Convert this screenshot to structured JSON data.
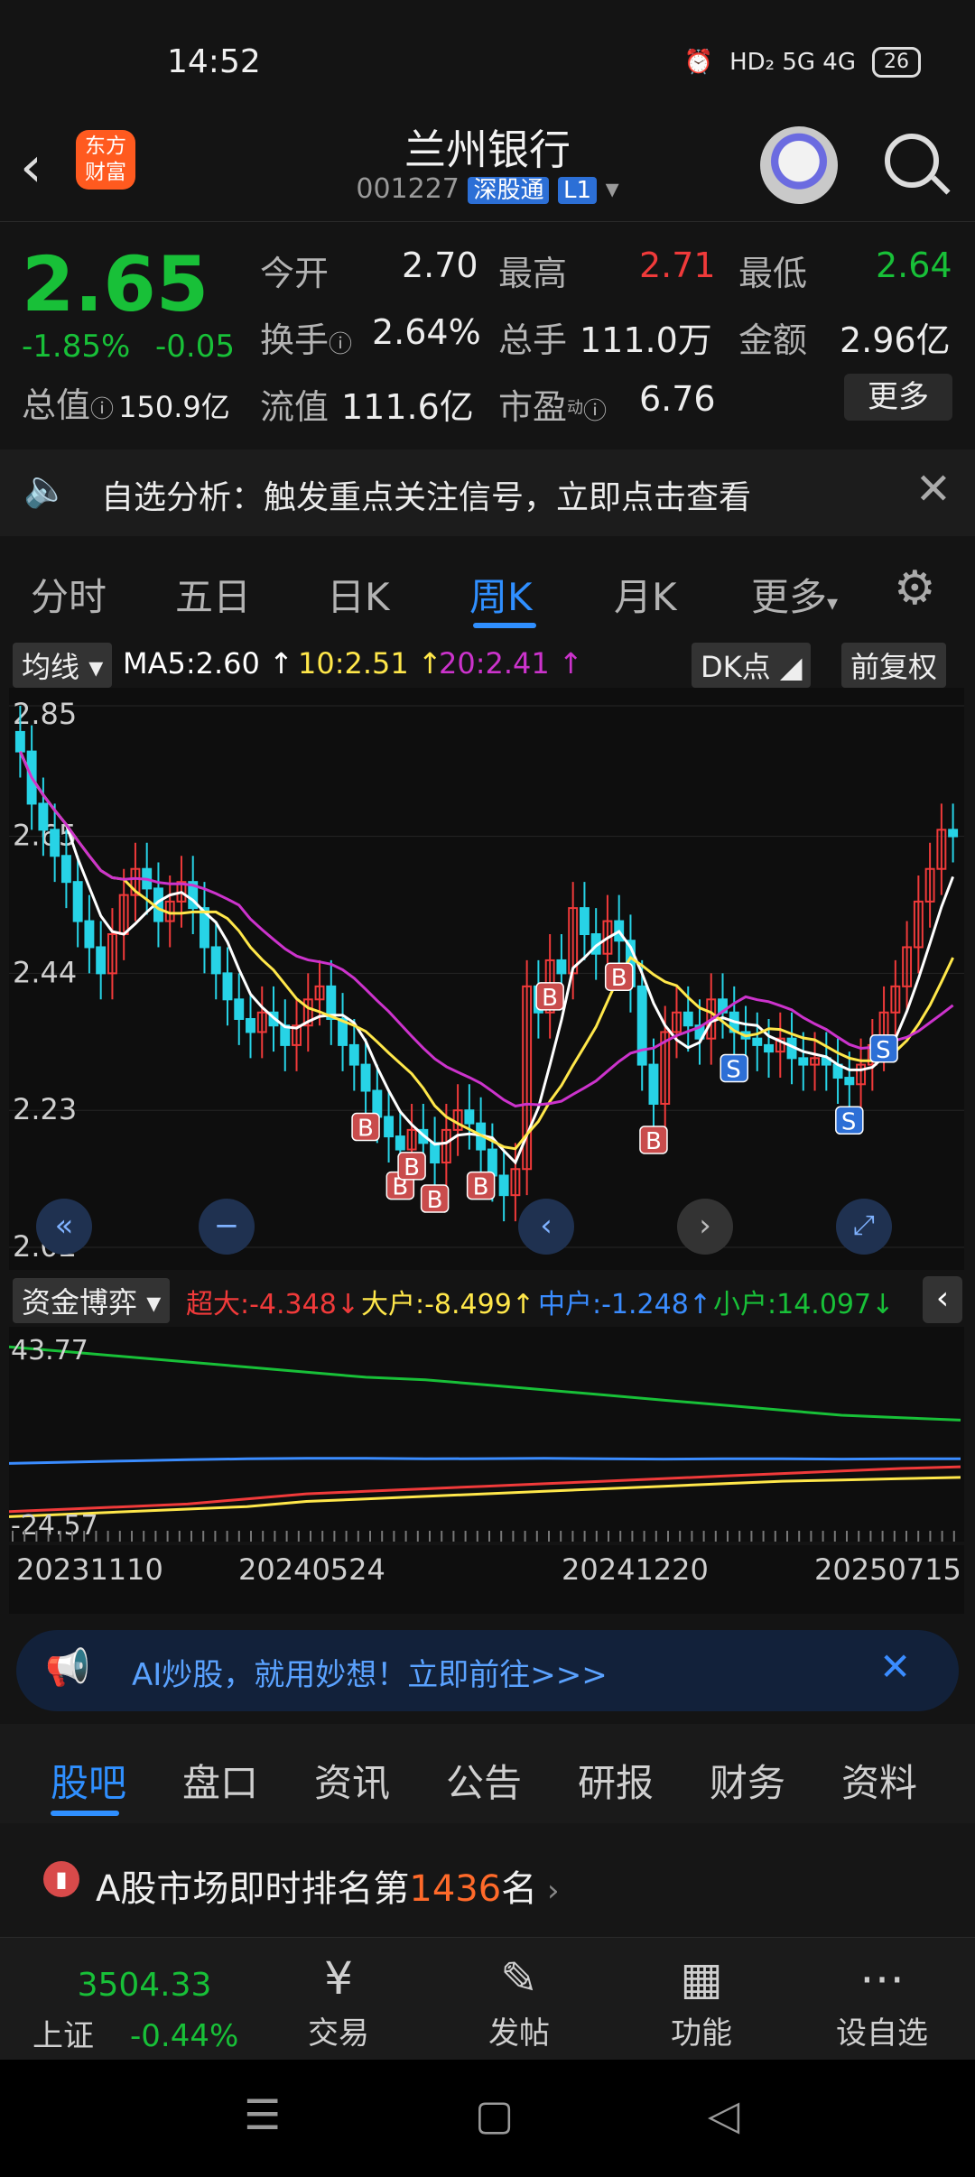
{
  "status_bar": {
    "time": "14:52",
    "network": "HD₂ 5G 4G",
    "battery": "26"
  },
  "header": {
    "logo_line1": "东方",
    "logo_line2": "财富",
    "title": "兰州银行",
    "code": "001227",
    "market_tag": "深股通",
    "level_tag": "L1"
  },
  "quote": {
    "price": "2.65",
    "change_pct": "-1.85%",
    "change_abs": "-0.05",
    "open_label": "今开",
    "open": "2.70",
    "high_label": "最高",
    "high": "2.71",
    "low_label": "最低",
    "low": "2.64",
    "turnover_label": "换手",
    "turnover": "2.64%",
    "volume_label": "总手",
    "volume": "111.0万",
    "amount_label": "金额",
    "amount": "2.96亿",
    "mktcap_label": "总值",
    "mktcap": "150.9亿",
    "float_label": "流值",
    "float": "111.6亿",
    "pe_label": "市盈",
    "pe_sup": "动",
    "pe": "6.76",
    "more": "更多"
  },
  "notice": {
    "text": "自选分析：触发重点关注信号，立即点击查看"
  },
  "tabs": [
    "分时",
    "五日",
    "日K",
    "周K",
    "月K",
    "更多"
  ],
  "chart_bar": {
    "indicator": "均线",
    "ma5": "MA5:2.60",
    "ma10": "10:2.51",
    "ma20": "20:2.41",
    "dk": "DK点",
    "adjust": "前复权"
  },
  "colors": {
    "up": "#f03a3a",
    "down": "#18c038",
    "ma5": "#ffffff",
    "ma10": "#ffe74a",
    "ma20": "#cc33cc",
    "accent": "#2f8fff"
  },
  "chart_data": [
    {
      "type": "candlestick",
      "title": "",
      "y_ticks": [
        "2.85",
        "2.65",
        "2.44",
        "2.23",
        "2.02"
      ],
      "ylim": [
        2.02,
        2.85
      ],
      "x_ticks": [
        "20231110",
        "20240524",
        "20241220",
        "20250715"
      ],
      "closes": [
        2.78,
        2.7,
        2.66,
        2.62,
        2.58,
        2.52,
        2.48,
        2.44,
        2.5,
        2.56,
        2.6,
        2.57,
        2.52,
        2.55,
        2.58,
        2.54,
        2.48,
        2.44,
        2.4,
        2.37,
        2.35,
        2.38,
        2.36,
        2.33,
        2.36,
        2.4,
        2.42,
        2.37,
        2.33,
        2.3,
        2.26,
        2.22,
        2.19,
        2.17,
        2.2,
        2.18,
        2.15,
        2.2,
        2.23,
        2.21,
        2.17,
        2.13,
        2.1,
        2.14,
        2.42,
        2.38,
        2.46,
        2.44,
        2.54,
        2.5,
        2.47,
        2.52,
        2.49,
        2.42,
        2.3,
        2.24,
        2.35,
        2.38,
        2.36,
        2.34,
        2.4,
        2.38,
        2.35,
        2.34,
        2.33,
        2.32,
        2.34,
        2.31,
        2.3,
        2.31,
        2.3,
        2.28,
        2.27,
        2.3,
        2.33,
        2.38,
        2.42,
        2.48,
        2.55,
        2.6,
        2.66,
        2.65
      ],
      "ma_series": [
        {
          "name": "MA5",
          "color": "#ffffff"
        },
        {
          "name": "10",
          "color": "#ffe74a"
        },
        {
          "name": "20",
          "color": "#cc33cc"
        }
      ],
      "markers": [
        "B",
        "B",
        "B",
        "B",
        "B",
        "B",
        "B",
        "B",
        "S",
        "S",
        "S"
      ]
    },
    {
      "type": "line",
      "title": "",
      "y_ticks": [
        "43.77",
        "-24.57"
      ],
      "ylim": [
        -24.57,
        43.77
      ],
      "series": [
        {
          "name": "超大",
          "latest": "-4.348",
          "color": "#f03a3a",
          "values": [
            -22,
            -21,
            -20,
            -19,
            -17,
            -15,
            -14,
            -13,
            -12,
            -11,
            -10,
            -9,
            -8,
            -7,
            -6,
            -5,
            -4.3
          ]
        },
        {
          "name": "大户",
          "latest": "-8.499",
          "color": "#ffe74a",
          "values": [
            -24,
            -23,
            -22,
            -21,
            -20,
            -18,
            -17,
            -16,
            -15,
            -14,
            -13,
            -12,
            -11,
            -10,
            -9.5,
            -9,
            -8.5
          ]
        },
        {
          "name": "中户",
          "latest": "-1.248",
          "color": "#3a8cff",
          "values": [
            -3,
            -2.5,
            -2,
            -1.5,
            -1.2,
            -1,
            -1,
            -1.2,
            -1.1,
            -1,
            -1.2,
            -1.3,
            -1.2,
            -1.2,
            -1.3,
            -1.2,
            -1.2
          ]
        },
        {
          "name": "小户",
          "latest": "14.097",
          "color": "#18c038",
          "values": [
            43,
            41,
            39,
            37,
            35,
            33,
            31,
            30,
            28,
            26,
            24,
            22,
            20,
            18,
            16,
            15,
            14.1
          ]
        }
      ]
    }
  ],
  "fund_bar": {
    "label": "资金博弈",
    "super_label": "超大:-4.348",
    "big_label": "大户:-8.499",
    "mid_label": "中户:-1.248",
    "small_label": "小户:14.097"
  },
  "ai_banner": {
    "text": "AI炒股，就用妙想！立即前往>>>"
  },
  "sub_tabs": [
    "股吧",
    "盘口",
    "资讯",
    "公告",
    "研报",
    "财务",
    "资料"
  ],
  "rank": {
    "prefix": "A股市场即时排名第",
    "num": "1436",
    "suffix": "名"
  },
  "bottom_bar": {
    "index_value": "3504.33",
    "index_name": "上证",
    "index_change": "-0.44%",
    "trade": "交易",
    "post": "发帖",
    "func": "功能",
    "watch": "设自选"
  }
}
